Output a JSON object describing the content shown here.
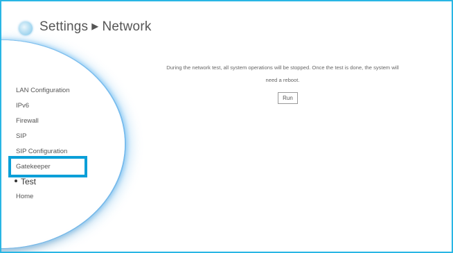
{
  "header": {
    "title": "Settings",
    "separator": "▶",
    "section": "Network"
  },
  "sidebar": {
    "items": [
      {
        "label": "LAN Configuration"
      },
      {
        "label": "IPv6"
      },
      {
        "label": "Firewall"
      },
      {
        "label": "SIP"
      },
      {
        "label": "SIP Configuration"
      },
      {
        "label": "Gatekeeper"
      },
      {
        "label": "Test"
      },
      {
        "label": "Home"
      }
    ],
    "active_item": "Test",
    "highlighted_item": "Gatekeeper"
  },
  "main": {
    "message": "During the network test, all system operations will be stopped. Once the test is done, the system will need a reboot.",
    "run_label": "Run"
  },
  "colors": {
    "frame_border": "#29b6e4",
    "highlight": "#0b9fd8"
  }
}
